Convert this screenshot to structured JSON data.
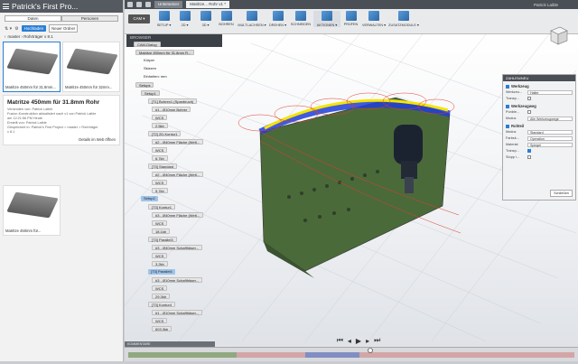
{
  "left_panel": {
    "title": "Patrick's First Pro...",
    "tabs": [
      "Daten",
      "Personen"
    ],
    "upload_label": "Hochladen",
    "new_folder_label": "Neuer Ordner",
    "breadcrumb": "master › Rohrträger v 8.1",
    "thumbs": [
      {
        "label": "Matritze 450mm für 31.8mm..."
      },
      {
        "label": "Matritze 450mm für 32mm..."
      }
    ],
    "detail": {
      "title": "Matritze 450mm für 31.8mm Rohr",
      "lines": [
        "Versenden von: Patrick Laible",
        "Fusion-Konstruktion aktualisiert nach v1 von Patrick Laible",
        "am 12:21:56 PM Heute",
        "Erstellt von: Patrick Laible",
        "Gespeichert in: Patrick's First Project > master > Rohrträger",
        "v 8.1"
      ],
      "link": "Details im Web öffnen"
    },
    "third_thumb": {
      "label": "Matritze 450mm für..."
    }
  },
  "tabbar": {
    "tabs": [
      {
        "label": "Untersetzer"
      },
      {
        "label": "Matritze... Rohr v1 *"
      }
    ],
    "user": "Patrick Laible"
  },
  "toolbar": {
    "cam": "CAM ▾",
    "tools": [
      {
        "label": "SETUP ▾"
      },
      {
        "label": "2D ▾"
      },
      {
        "label": "3D ▾"
      },
      {
        "label": "BOHREN"
      },
      {
        "label": "MULTI-ACHSEN ▾"
      },
      {
        "label": "DREHEN ▾"
      },
      {
        "label": "SCHNEIDEN"
      },
      {
        "label": "AKTIONEN ▾"
      },
      {
        "label": "PRÜFEN"
      },
      {
        "label": "VERWALTEN ▾"
      },
      {
        "label": "ZUSATZMODULE ▾"
      }
    ]
  },
  "browser": {
    "title": "BROWSER",
    "nodes": [
      {
        "label": "CAM-Dialog"
      },
      {
        "label": "Matritze 450mm für 31.8mm R..."
      },
      {
        "label": "Körper"
      },
      {
        "label": "Skizzen"
      },
      {
        "label": "Einheiten: mm"
      },
      {
        "label": "Setups"
      },
      {
        "label": "Setup1"
      },
      {
        "label": "[T1] Bohren1 (Spanbruch)"
      },
      {
        "label": "#1 - Ø10mm Bohrer"
      },
      {
        "label": "WCS"
      },
      {
        "label": "2.5kb"
      },
      {
        "label": "[T2] 2D-Kontur1"
      },
      {
        "label": "#2 - Ø40mm Fläche (Welt..."
      },
      {
        "label": "WCS"
      },
      {
        "label": "6.7kb"
      },
      {
        "label": "[T3] Standard"
      },
      {
        "label": "#2 - Ø40mm Fläche (Welt..."
      },
      {
        "label": "WCS"
      },
      {
        "label": "5.7kb"
      },
      {
        "label": "Setup2"
      },
      {
        "label": "[T3] Kontur1"
      },
      {
        "label": "#3 - Ø40mm Fläche (Welt..."
      },
      {
        "label": "WCS"
      },
      {
        "label": "18.1kb"
      },
      {
        "label": "[T3] Parallel3"
      },
      {
        "label": "#3 - Ø40mm Schaftfräser..."
      },
      {
        "label": "WCS"
      },
      {
        "label": "3.2kb"
      },
      {
        "label": "[T3] Parallel4"
      },
      {
        "label": "#3 - Ø10mm Schaftfräser..."
      },
      {
        "label": "WCS"
      },
      {
        "label": "29.3kb"
      },
      {
        "label": "[T3] Kontur4"
      },
      {
        "label": "#1 - Ø10mm Schaftfräser..."
      },
      {
        "label": "WCS"
      },
      {
        "label": "603.3kb"
      }
    ]
  },
  "panel": {
    "title": "ZAHLEN/NEU",
    "werkzeug": {
      "title": "Werkzeug",
      "fields": [
        {
          "k": "Werkzeu...",
          "v": "Halter"
        },
        {
          "k": "Transp...",
          "v": ""
        }
      ]
    },
    "werkzeugweg": {
      "title": "Werkzeugweg",
      "fields": [
        {
          "k": "Punkte...",
          "v": ""
        },
        {
          "k": "Modus",
          "v": "Alle Werkzeugwege"
        }
      ]
    },
    "rohteil": {
      "title": "Rohteil",
      "fields": [
        {
          "k": "Modus",
          "v": "Standard"
        },
        {
          "k": "Farbsk...",
          "v": "Operation"
        },
        {
          "k": "Material",
          "v": "Spiegel"
        },
        {
          "k": "Transp...",
          "v": ""
        },
        {
          "k": "Stopp i...",
          "v": ""
        }
      ]
    },
    "close": "Schließen"
  },
  "bottom": {
    "kommentare": "KOMMENTARE"
  },
  "colors": {
    "accent": "#2a7fd6",
    "part": "#4d6a3e",
    "toolpath_blue": "#1f3ddb",
    "toolpath_yellow": "#f5e400",
    "toolpath_red": "#e53b2e"
  }
}
